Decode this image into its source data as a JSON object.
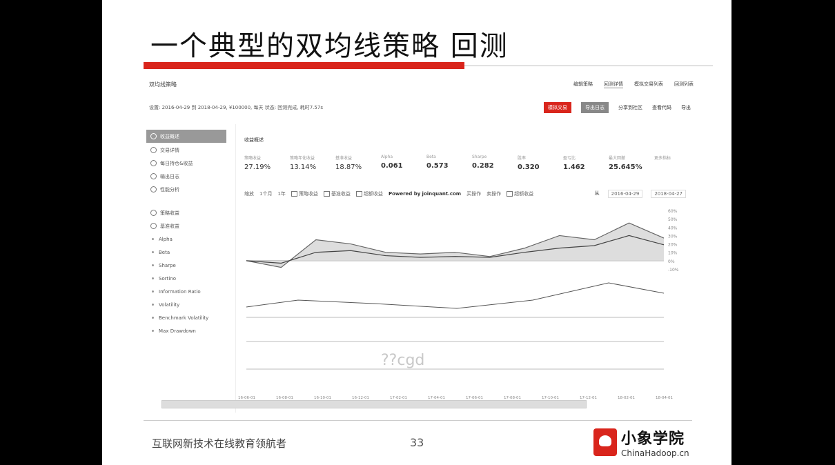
{
  "slide": {
    "title": "一个典型的双均线策略  回测",
    "footer_text": "互联网新技术在线教育领航者",
    "page_number": "33",
    "logo_name": "小象学院",
    "logo_sub": "ChinaHadoop.cn",
    "watermark": "??cgd"
  },
  "screenshot": {
    "strategy_name": "双均线策略",
    "top_nav": [
      "编辑策略",
      "回测详情",
      "模拟交易列表",
      "回测列表"
    ],
    "settings": "设置: 2016-04-29 到 2018-04-29, ¥100000, 每天   状态: 回测完成, 耗时7.57s",
    "actions": {
      "btn1": "模拟交易",
      "btn2": "导出日志",
      "share": "分享到社区",
      "code": "查看代码",
      "export": "导出"
    },
    "sidebar": {
      "items": [
        {
          "label": "收益概述",
          "active": true
        },
        {
          "label": "交易详情"
        },
        {
          "label": "每日持仓&收益"
        },
        {
          "label": "输出日志"
        },
        {
          "label": "性能分析"
        }
      ],
      "items2": [
        {
          "label": "策略收益"
        },
        {
          "label": "基准收益"
        }
      ],
      "metrics": [
        "Alpha",
        "Beta",
        "Sharpe",
        "Sortino",
        "Information Ratio",
        "Volatility",
        "Benchmark Volatility",
        "Max Drawdown"
      ]
    },
    "section_title": "收益概述",
    "metrics": [
      {
        "label": "策略收益",
        "value": "27.19%"
      },
      {
        "label": "策略年化收益",
        "value": "13.14%"
      },
      {
        "label": "基准收益",
        "value": "18.87%"
      },
      {
        "label": "Alpha",
        "value": "0.061"
      },
      {
        "label": "Beta",
        "value": "0.573"
      },
      {
        "label": "Sharpe",
        "value": "0.282"
      },
      {
        "label": "胜率",
        "value": "0.320"
      },
      {
        "label": "盈亏比",
        "value": "1.462"
      },
      {
        "label": "最大回撤",
        "value": "25.645%"
      },
      {
        "label": "更多指标",
        "value": ""
      }
    ],
    "controls": {
      "zoom_label": "缩放",
      "zoom_options": [
        "1个月",
        "1年"
      ],
      "legend_strategy": "策略收益",
      "legend_benchmark": "基准收益",
      "legend_excess": "超额收益",
      "powered_by": "Powered by",
      "powered_site": "joinquant.com",
      "buy": "买操作",
      "sell": "卖操作",
      "log_axis": "超额收益",
      "date_label": "从",
      "start_date": "2016-04-29",
      "end_date": "2018-04-27"
    }
  },
  "chart_data": {
    "type": "line",
    "x": [
      "16-04-29",
      "16-07-01",
      "16-09-01",
      "16-11-01",
      "17-01-01",
      "17-03-01",
      "17-05-01",
      "17-07-01",
      "17-09-01",
      "17-11-01",
      "18-01-01",
      "18-03-01",
      "18-04-27"
    ],
    "series": [
      {
        "name": "策略收益",
        "values": [
          0,
          -8,
          25,
          20,
          10,
          8,
          10,
          5,
          15,
          30,
          25,
          45,
          27
        ]
      },
      {
        "name": "基准收益",
        "values": [
          0,
          -3,
          10,
          12,
          6,
          4,
          5,
          4,
          10,
          15,
          18,
          30,
          19
        ]
      }
    ],
    "ylim": [
      -10,
      60
    ],
    "y_ticks": [
      "60%",
      "50%",
      "40%",
      "30%",
      "20%",
      "10%",
      "0%",
      "-10%"
    ],
    "x_ticks": [
      "16-06-01",
      "16-08-01",
      "16-10-01",
      "16-12-01",
      "17-02-01",
      "17-04-01",
      "17-06-01",
      "17-08-01",
      "17-10-01",
      "17-12-01",
      "18-02-01",
      "18-04-01"
    ]
  }
}
